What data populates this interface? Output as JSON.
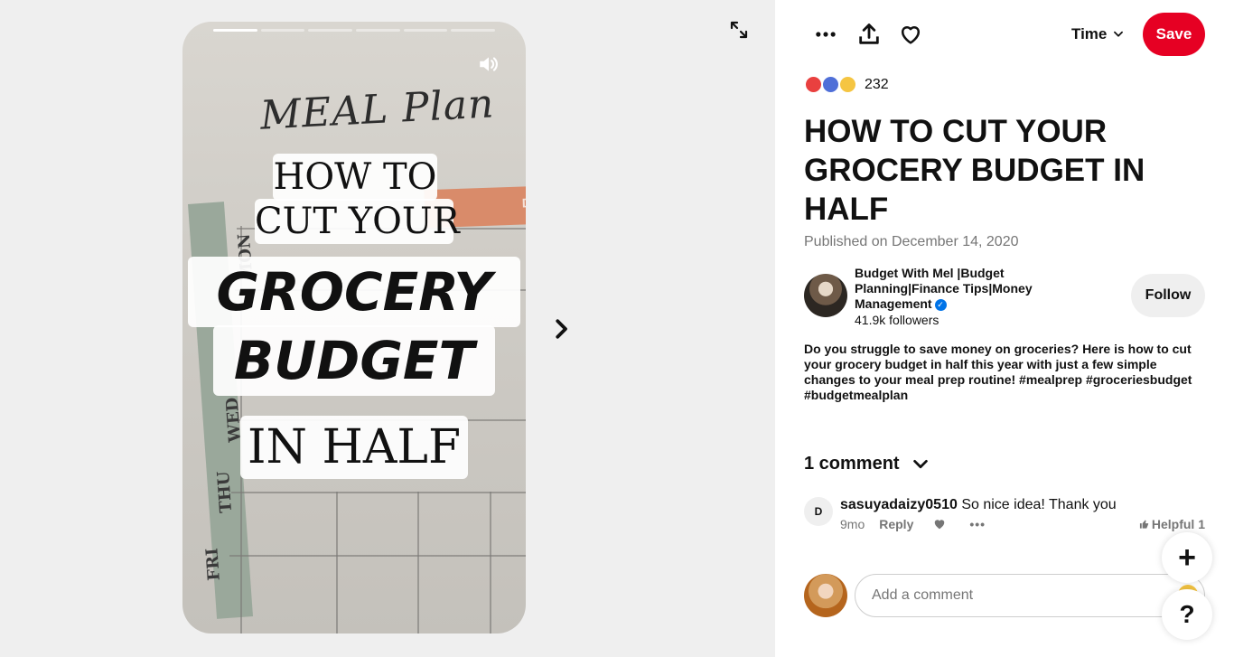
{
  "story": {
    "progress_total": 6,
    "progress_active": 1,
    "background_text": {
      "meal_plan": "MEAL Plan",
      "orange_tab": "DI",
      "days": [
        "MON",
        "WED",
        "THU",
        "FRI"
      ]
    },
    "overlay_lines": {
      "line1": "HOW TO",
      "line2": "CUT YOUR",
      "line3": "GROCERY",
      "line4": "BUDGET",
      "line5": "IN HALF"
    }
  },
  "toolbar": {
    "time_label": "Time",
    "save_label": "Save"
  },
  "reactions": {
    "count": "232"
  },
  "pin": {
    "title": "HOW TO CUT YOUR GROCERY BUDGET IN HALF",
    "published": "Published on December 14, 2020",
    "description": "Do you struggle to save money on groceries? Here is how to cut your grocery budget in half this year with just a few simple changes to your meal prep routine! #mealprep #groceriesbudget #budgetmealplan"
  },
  "creator": {
    "name": "Budget With Mel |Budget Planning|Finance Tips|Money Management",
    "followers": "41.9k followers",
    "follow_label": "Follow"
  },
  "comments": {
    "header": "1 comment",
    "items": [
      {
        "avatar_letter": "D",
        "user": "sasuyadaizy0510",
        "text": "So nice idea! Thank you",
        "age": "9mo",
        "reply_label": "Reply",
        "helpful_label": "Helpful 1"
      }
    ]
  },
  "add_comment": {
    "placeholder": "Add a comment"
  },
  "fabs": {
    "plus": "+",
    "help": "?"
  },
  "colors": {
    "save_red": "#e60023",
    "verified_blue": "#0074e8"
  }
}
